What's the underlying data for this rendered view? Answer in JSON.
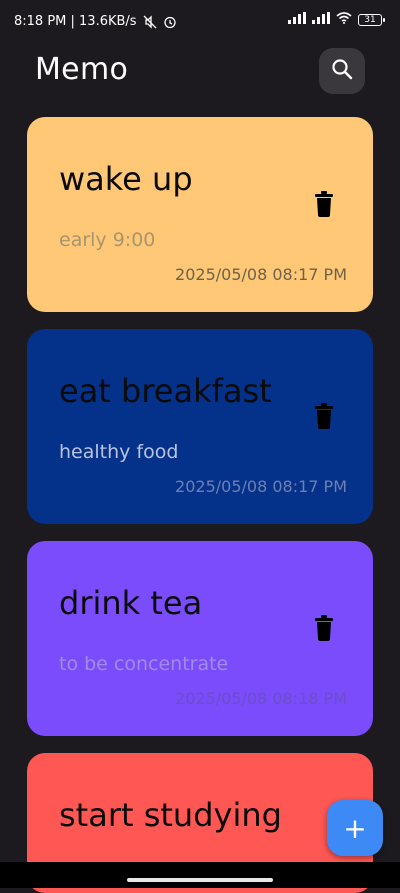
{
  "status_bar": {
    "time_speed": "8:18 PM | 13.6KB/s",
    "battery": "31"
  },
  "header": {
    "title": "Memo",
    "search_icon": "search-icon"
  },
  "memos": [
    {
      "title": "wake up",
      "body": "early 9:00",
      "date": "2025/05/08  08:17 PM",
      "color": "#ffc876",
      "body_color": "#a8956e",
      "date_color": "#6e6249"
    },
    {
      "title": "eat breakfast",
      "body": "healthy food",
      "date": "2025/05/08  08:17 PM",
      "color": "#04318a",
      "body_color": "#b9c3df",
      "date_color": "#6f7fb0"
    },
    {
      "title": "drink tea",
      "body": "to be concentrate",
      "date": "2025/05/08  08:18 PM",
      "color": "#7a4cfb",
      "body_color": "#a48ae8",
      "date_color": "#6b4fc6"
    },
    {
      "title": "start studying",
      "body": "",
      "date": "",
      "color": "#ff5753",
      "body_color": "#ffb2b0",
      "date_color": "#c94543"
    }
  ],
  "fab": {
    "label": "+"
  }
}
